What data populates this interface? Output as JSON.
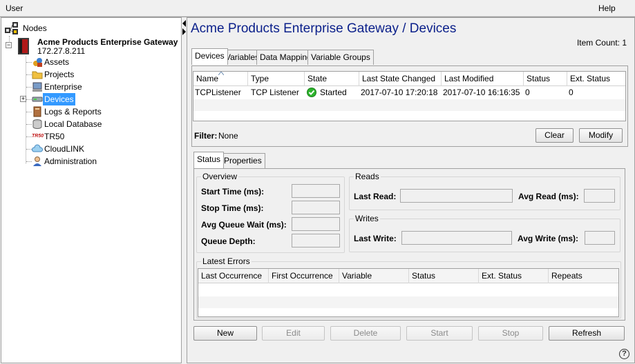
{
  "menu": {
    "user": "User",
    "help": "Help"
  },
  "tree": {
    "root": "Nodes",
    "gateway_name": "Acme Products Enterprise Gateway",
    "gateway_ip": "172.27.8.211",
    "items": [
      {
        "label": "Assets",
        "icon": "assets-icon"
      },
      {
        "label": "Projects",
        "icon": "folder-icon"
      },
      {
        "label": "Enterprise",
        "icon": "enterprise-icon"
      },
      {
        "label": "Devices",
        "icon": "devices-icon",
        "selected": true,
        "expandable": true
      },
      {
        "label": "Logs & Reports",
        "icon": "book-icon"
      },
      {
        "label": "Local Database",
        "icon": "database-icon"
      },
      {
        "label": "TR50",
        "icon": "tr50-icon",
        "icon_text": "TR50"
      },
      {
        "label": "CloudLINK",
        "icon": "cloud-icon"
      },
      {
        "label": "Administration",
        "icon": "admin-icon"
      }
    ]
  },
  "main": {
    "title": "Acme Products Enterprise Gateway / Devices",
    "item_count": "Item Count: 1",
    "tabs": [
      "Devices",
      "Variables",
      "Data Mapping",
      "Variable Groups"
    ],
    "devices_table": {
      "columns": [
        "Name",
        "Type",
        "State",
        "Last State Changed",
        "Last Modified",
        "Status",
        "Ext. Status"
      ],
      "rows": [
        {
          "name": "TCPListener",
          "type": "TCP Listener",
          "state": "Started",
          "last_state_changed": "2017-07-10 17:20:18",
          "last_modified": "2017-07-10 16:16:35",
          "status": "0",
          "ext_status": "0"
        }
      ]
    },
    "filter_label": "Filter:",
    "filter_value": "None",
    "clear_label": "Clear",
    "modify_label": "Modify",
    "detail_tabs": [
      "Status",
      "Properties"
    ],
    "overview": {
      "title": "Overview",
      "start_time": "Start Time (ms):",
      "stop_time": "Stop Time (ms):",
      "avg_queue_wait": "Avg Queue Wait (ms):",
      "queue_depth": "Queue Depth:"
    },
    "reads": {
      "title": "Reads",
      "last_read": "Last Read:",
      "avg_read": "Avg Read (ms):"
    },
    "writes": {
      "title": "Writes",
      "last_write": "Last Write:",
      "avg_write": "Avg Write (ms):"
    },
    "errors": {
      "title": "Latest Errors",
      "columns": [
        "Last Occurrence",
        "First Occurrence",
        "Variable",
        "Status",
        "Ext. Status",
        "Repeats"
      ]
    },
    "buttons": {
      "new": "New",
      "edit": "Edit",
      "delete": "Delete",
      "start": "Start",
      "stop": "Stop",
      "refresh": "Refresh"
    },
    "help_glyph": "?"
  },
  "colors": {
    "title": "#0a1f8a",
    "selection": "#3399ff",
    "started": "#2db32d"
  }
}
